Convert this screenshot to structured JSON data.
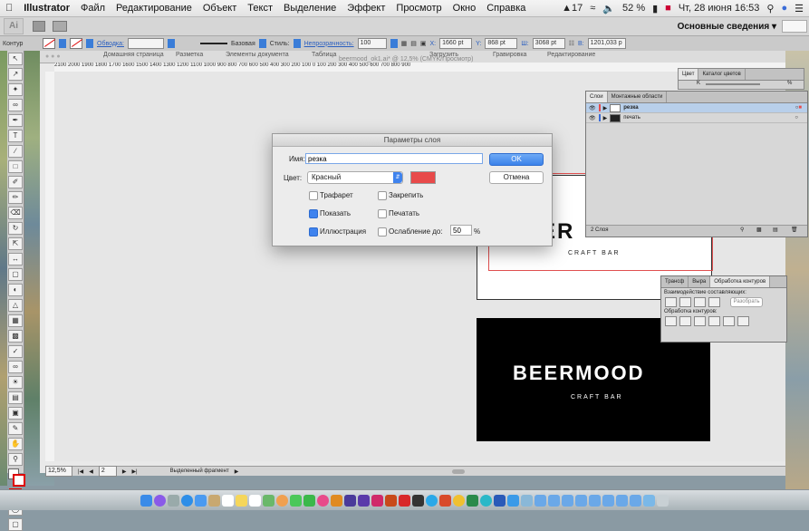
{
  "menubar": {
    "apple": "",
    "items": [
      "Illustrator",
      "Файл",
      "Редактирование",
      "Объект",
      "Текст",
      "Выделение",
      "Эффект",
      "Просмотр",
      "Окно",
      "Справка"
    ],
    "status": {
      "adobe": "17",
      "battery": "52 %",
      "datetime": "Чт, 28 июня 16:53"
    }
  },
  "appbar": {
    "logo": "Ai",
    "workspace": "Основные сведения ▾"
  },
  "ctrlbar": {
    "selection": "Контур",
    "stroke_label": "Обводка:",
    "stroke_style": "Базовая",
    "style_label": "Стиль:",
    "opacity_label": "Непрозрачность:",
    "opacity_value": "100",
    "x_label": "X:",
    "x_value": "1660 pt",
    "y_label": "Y:",
    "y_value": "868 pt",
    "w_label": "Ш:",
    "w_value": "3068 pt",
    "h_label": "В:",
    "h_value": "1201,033 p"
  },
  "document": {
    "tabs": [
      "Домашняя страница",
      "Разметка",
      "Элементы документа",
      "Таблица",
      "Загрузить",
      "Гравировка",
      "Редактирование"
    ],
    "title": "beermood_ok1.ai* @ 12,5% (CMYK/Просмотр)",
    "ruler_top": "2100  2000  1900  1800  1700  1600  1500  1400  1300  1200  1100  1000  900  800  700  600  500  400  300  200  100  0   100  200  300  400  500  600  700  800  900",
    "zoom": "12,5%",
    "page": "2",
    "status_text": "Выделенный фрагмент"
  },
  "artboards": {
    "brand": "BEERMOOD",
    "brand_partial": "ER",
    "tagline": "CRAFT BAR"
  },
  "dialog": {
    "title": "Параметры слоя",
    "name_label": "Имя:",
    "name_value": "резка",
    "color_label": "Цвет:",
    "color_value": "Красный",
    "swatch": "#e84a4a",
    "ok": "OK",
    "cancel": "Отмена",
    "template": "Трафарет",
    "lock": "Закрепить",
    "show": "Показать",
    "print": "Печатать",
    "preview": "Иллюстрация",
    "dim": "Ослабление до:",
    "dim_value": "50",
    "dim_unit": "%"
  },
  "layers": {
    "tabs": [
      "Слои",
      "Монтажные области"
    ],
    "rows": [
      {
        "name": "резка"
      },
      {
        "name": "печать"
      }
    ],
    "count": "2 Слоя"
  },
  "colorpanel": {
    "tabs": [
      "Цвет",
      "Каталог цветов"
    ],
    "k_label": "K",
    "k_unit": "%"
  },
  "pathfinder": {
    "tabs": [
      "Трансф",
      "Выра",
      "Обработка контуров"
    ],
    "modes_label": "Взаимодействие составляющих:",
    "expand": "Разобрать",
    "pathfinders_label": "Обработка контуров:"
  },
  "colors": {
    "accent": "#3b82ea",
    "artboard_guide": "#e05050",
    "dock_bg": "#b5bec3"
  }
}
